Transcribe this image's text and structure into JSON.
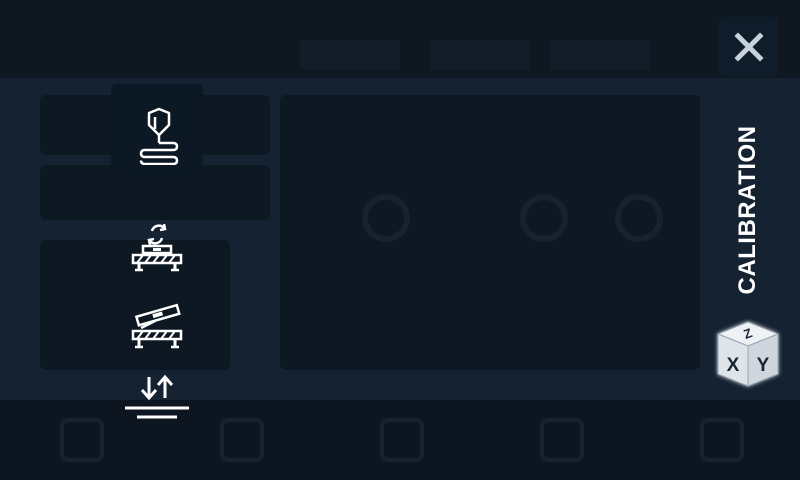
{
  "panel": {
    "title": "CALIBRATION"
  },
  "menu": {
    "items": [
      {
        "name": "filament-load",
        "icon": "nozzle-filament-icon",
        "active": true
      },
      {
        "name": "auto-bed-level",
        "icon": "bed-level-auto-icon",
        "active": false
      },
      {
        "name": "manual-bed-level",
        "icon": "bed-level-manual-icon",
        "active": false
      },
      {
        "name": "z-offset",
        "icon": "z-offset-icon",
        "active": false
      }
    ]
  },
  "close": {
    "icon": "close-icon"
  },
  "axes": {
    "x": "X",
    "y": "Y",
    "z": "Z"
  },
  "colors": {
    "background": "#142232",
    "active_item": "#0c1824",
    "icon": "#ffffff"
  }
}
